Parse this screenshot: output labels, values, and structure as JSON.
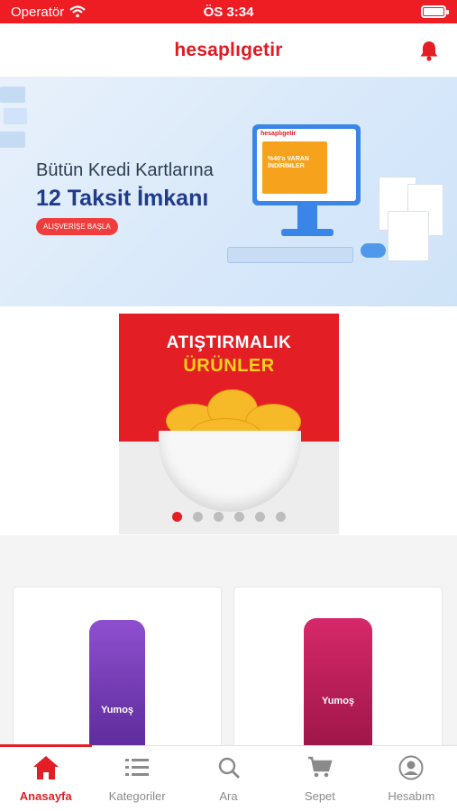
{
  "status_bar": {
    "carrier": "Operatör",
    "time": "ÖS 3:34",
    "battery_level": 1.0
  },
  "header": {
    "brand": "hesaplıgetir"
  },
  "hero": {
    "line1": "Bütün Kredi Kartlarına",
    "line2": "12 Taksit İmkanı",
    "cta": "ALIŞVERİŞE BAŞLA",
    "monitor_brand": "hesaplıgetir",
    "monitor_promo": "%40'a VARAN İNDİRİMLER"
  },
  "promo": {
    "title": "ATIŞTIRMALIK",
    "subtitle": "ÜRÜNLER",
    "slide_count": 6,
    "active_slide": 0
  },
  "products": [
    {
      "label": "Yumoş",
      "color": "#7b3fb8"
    },
    {
      "label": "Yumoş",
      "color": "#c21a5d"
    }
  ],
  "tabbar": {
    "tabs": [
      {
        "label": "Anasayfa",
        "icon": "home-icon",
        "active": true
      },
      {
        "label": "Kategoriler",
        "icon": "list-icon",
        "active": false
      },
      {
        "label": "Ara",
        "icon": "search-icon",
        "active": false
      },
      {
        "label": "Sepet",
        "icon": "cart-icon",
        "active": false
      },
      {
        "label": "Hesabım",
        "icon": "account-icon",
        "active": false
      }
    ]
  },
  "colors": {
    "accent": "#e31e24",
    "brand": "#e11a22",
    "inactive": "#8a8a8a"
  }
}
